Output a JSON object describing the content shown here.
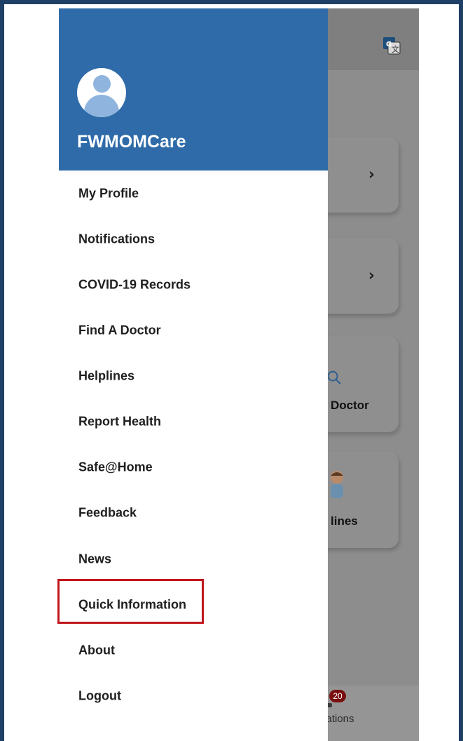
{
  "drawer": {
    "app_name": "FWMOMCare",
    "avatar_icon": "user-avatar-icon",
    "items": [
      {
        "label": "My Profile"
      },
      {
        "label": "Notifications"
      },
      {
        "label": "COVID-19 Records"
      },
      {
        "label": "Find A Doctor"
      },
      {
        "label": "Helplines"
      },
      {
        "label": "Report Health"
      },
      {
        "label": "Safe@Home"
      },
      {
        "label": "Feedback"
      },
      {
        "label": "News"
      },
      {
        "label": "Quick Information"
      },
      {
        "label": "About"
      },
      {
        "label": "Logout"
      }
    ],
    "highlighted_item": "Quick Information"
  },
  "background": {
    "translate_icon": "google-translate-icon",
    "cards": [
      {
        "label": "",
        "icon": "chevron-right-icon"
      },
      {
        "label": "",
        "icon": "chevron-right-icon"
      },
      {
        "label": "Doctor",
        "icon": "search-icon"
      },
      {
        "label": "lines",
        "icon": "agent-avatar-icon"
      }
    ],
    "bottom_nav": {
      "badge_count": "20",
      "label": "cations"
    }
  },
  "colors": {
    "header_blue": "#2e6ba8",
    "frame_border": "#1f3f66",
    "highlight_red": "#c0171d"
  }
}
